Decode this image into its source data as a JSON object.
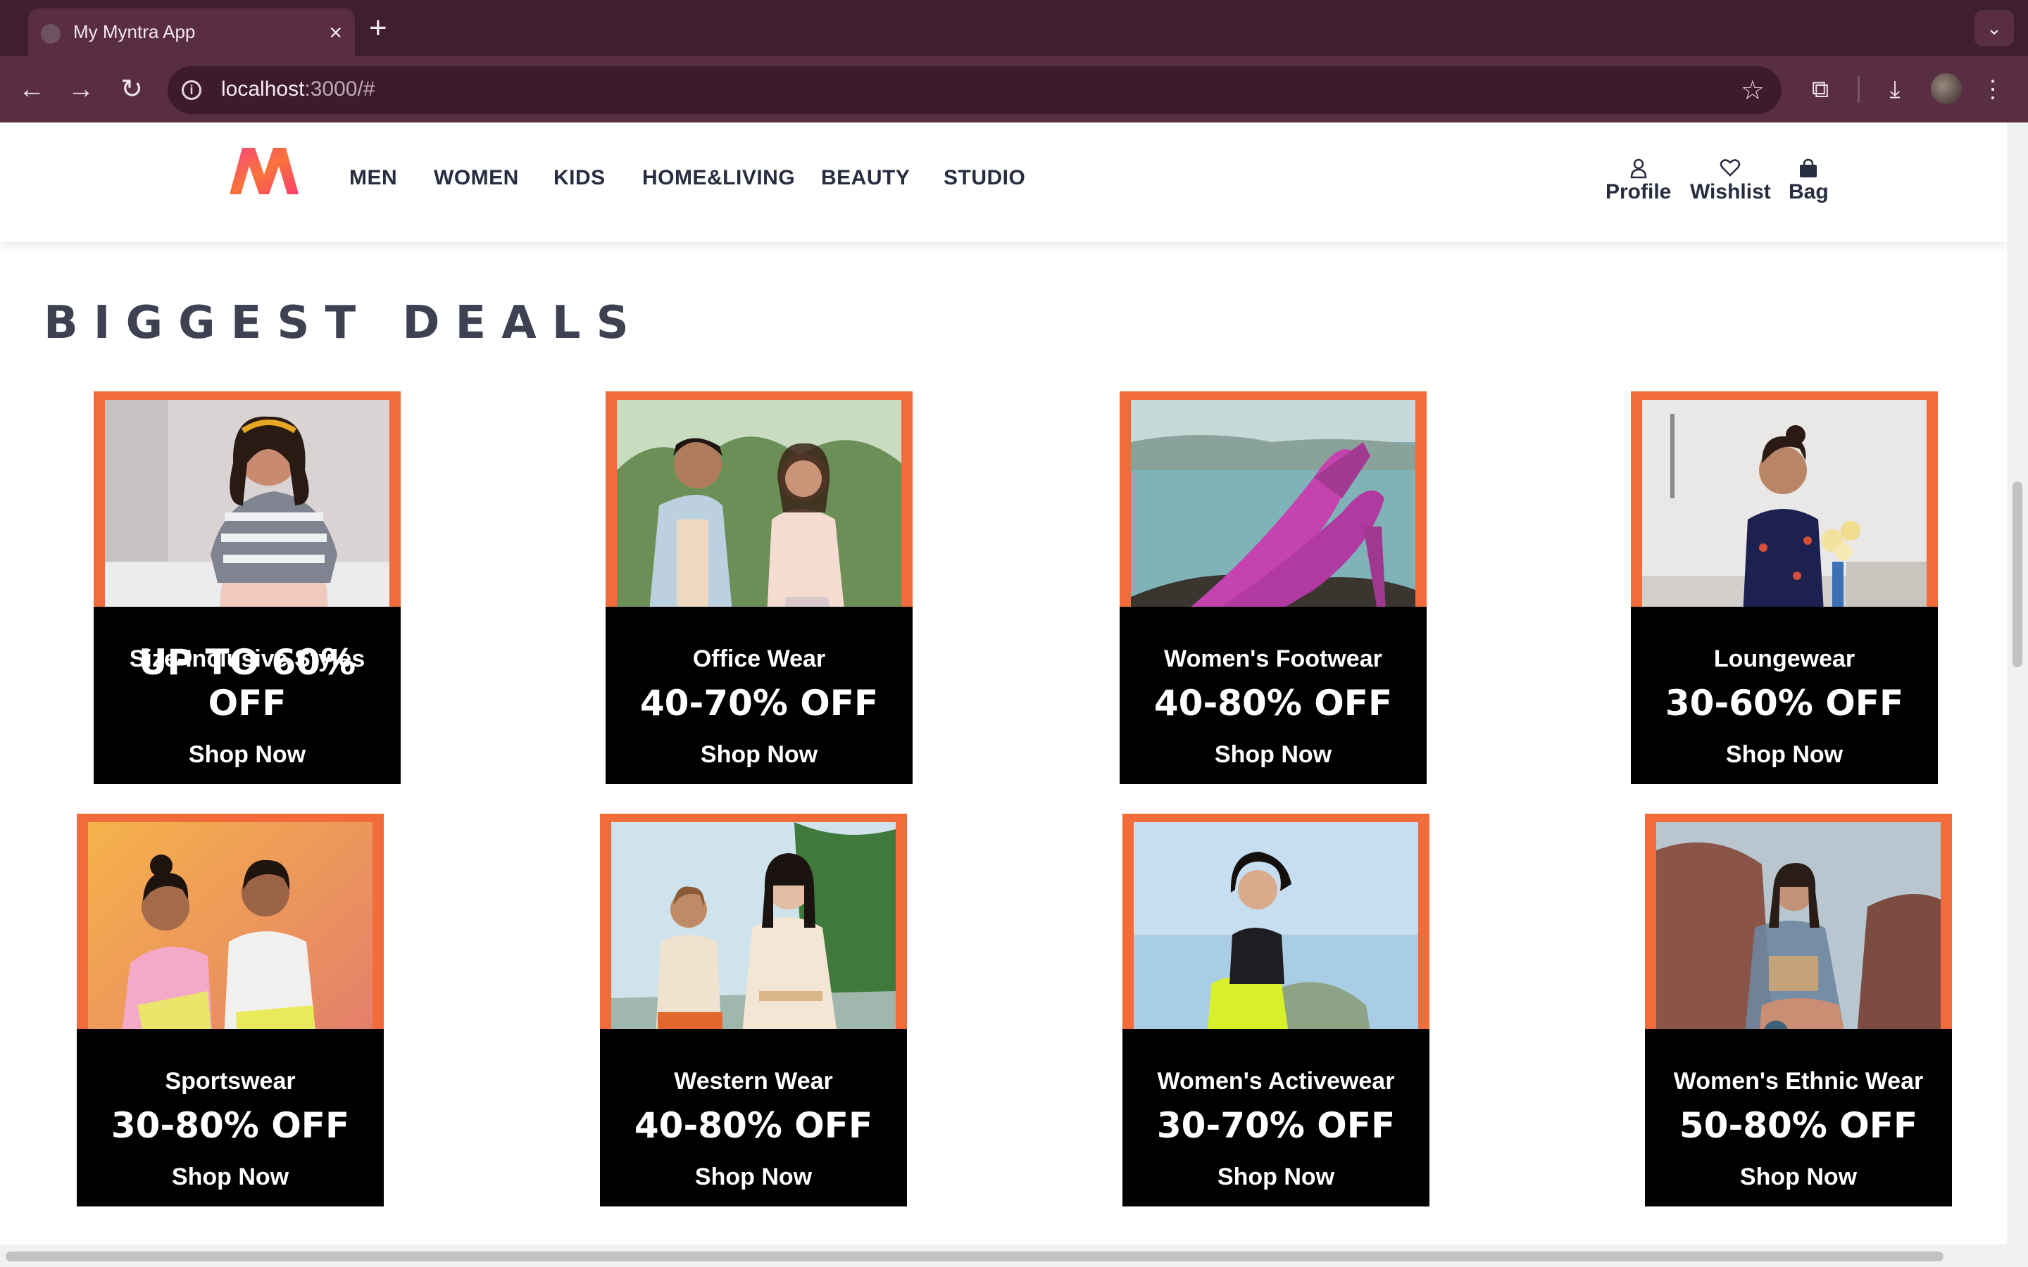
{
  "browser": {
    "tab_title": "My Myntra App",
    "url_host": "localhost",
    "url_path": ":3000/#"
  },
  "nav": {
    "links": [
      "MEN",
      "WOMEN",
      "KIDS",
      "HOME&LIVING",
      "BEAUTY",
      "STUDIO"
    ],
    "actions": {
      "profile": "Profile",
      "wishlist": "Wishlist",
      "bag": "Bag"
    }
  },
  "section_title": "BIGGEST DEALS",
  "deals": [
    {
      "category": "Size-Inclusive Styles",
      "offer": "UP TO 60% OFF",
      "cta": "Shop Now"
    },
    {
      "category": "Office Wear",
      "offer": "40-70% OFF",
      "cta": "Shop Now"
    },
    {
      "category": "Women's Footwear",
      "offer": "40-80% OFF",
      "cta": "Shop Now"
    },
    {
      "category": "Loungewear",
      "offer": "30-60% OFF",
      "cta": "Shop Now"
    },
    {
      "category": "Sportswear",
      "offer": "30-80% OFF",
      "cta": "Shop Now"
    },
    {
      "category": "Western Wear",
      "offer": "40-80% OFF",
      "cta": "Shop Now"
    },
    {
      "category": "Women's Activewear",
      "offer": "30-70% OFF",
      "cta": "Shop Now"
    },
    {
      "category": "Women's Ethnic Wear",
      "offer": "50-80% OFF",
      "cta": "Shop Now"
    }
  ],
  "colors": {
    "tile_border": "#f26b3a",
    "band": "#000000",
    "nav_text": "#282c3f",
    "chrome": "#5a2e42"
  }
}
